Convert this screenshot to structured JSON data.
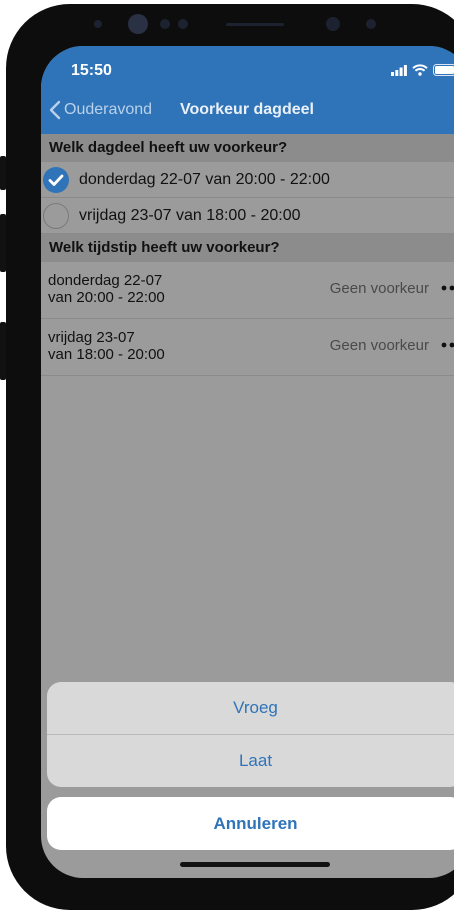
{
  "status_bar": {
    "time": "15:50"
  },
  "nav": {
    "back_label": "Ouderavond",
    "title": "Voorkeur dagdeel"
  },
  "section1": {
    "title": "Welk dagdeel heeft uw voorkeur?",
    "options": [
      {
        "label": "donderdag 22-07 van 20:00 - 22:00",
        "selected": true
      },
      {
        "label": "vrijdag 23-07 van 18:00 - 20:00",
        "selected": false
      }
    ]
  },
  "section2": {
    "title": "Welk tijdstip heeft uw voorkeur?",
    "rows": [
      {
        "day": "donderdag 22-07",
        "time": "van 20:00 - 22:00",
        "preference": "Geen voorkeur"
      },
      {
        "day": "vrijdag 23-07",
        "time": "van 18:00 - 20:00",
        "preference": "Geen voorkeur"
      }
    ]
  },
  "action_sheet": {
    "options": [
      "Vroeg",
      "Laat"
    ],
    "cancel": "Annuleren"
  },
  "colors": {
    "accent": "#2f74b8",
    "dimmed_background": "#9b9b9b"
  }
}
